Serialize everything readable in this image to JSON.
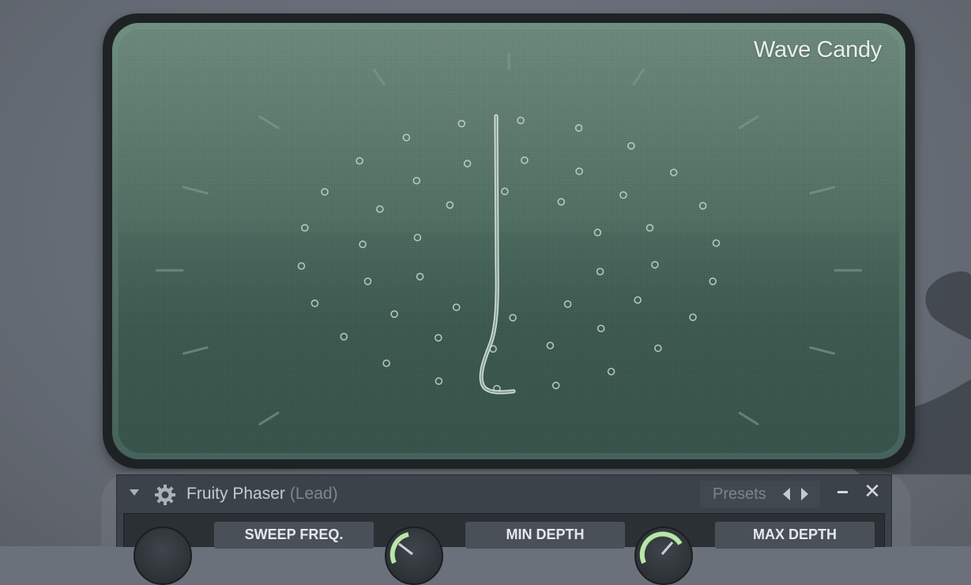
{
  "visualizer": {
    "title": "Wave Candy"
  },
  "plugin": {
    "name": "Fruity Phaser",
    "target": "(Lead)",
    "presets_label": "Presets",
    "controls": [
      {
        "label": "SWEEP FREQ."
      },
      {
        "label": "MIN DEPTH"
      },
      {
        "label": "MAX DEPTH"
      }
    ]
  },
  "colors": {
    "screen": "#4f6e62",
    "frame": "#1f2225",
    "panel": "#3c4249",
    "accent_knob": "#b7e6a6"
  },
  "icons": [
    "gear-icon",
    "dropdown-arrow-icon",
    "prev-preset-icon",
    "next-preset-icon",
    "minimize-icon",
    "close-icon"
  ]
}
